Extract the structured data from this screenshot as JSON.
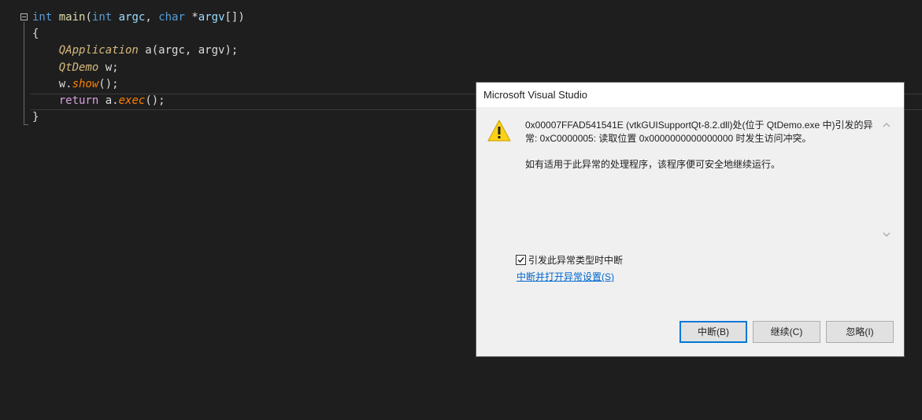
{
  "editor": {
    "lines": [
      {
        "tokens": [
          {
            "t": "int",
            "c": "kw"
          },
          {
            "t": " ",
            "c": "tx"
          },
          {
            "t": "main",
            "c": "fn"
          },
          {
            "t": "(",
            "c": "tx"
          },
          {
            "t": "int",
            "c": "kw"
          },
          {
            "t": " ",
            "c": "tx"
          },
          {
            "t": "argc",
            "c": "vr"
          },
          {
            "t": ", ",
            "c": "tx"
          },
          {
            "t": "char",
            "c": "kw"
          },
          {
            "t": " *",
            "c": "tx"
          },
          {
            "t": "argv",
            "c": "vr"
          },
          {
            "t": "[])",
            "c": "tx"
          }
        ]
      },
      {
        "tokens": [
          {
            "t": "{",
            "c": "tx"
          }
        ]
      },
      {
        "tokens": [
          {
            "t": "    ",
            "c": "tx"
          },
          {
            "t": "QApplication",
            "c": "ty-i"
          },
          {
            "t": " a(argc, argv);",
            "c": "tx"
          }
        ]
      },
      {
        "tokens": [
          {
            "t": "    ",
            "c": "tx"
          },
          {
            "t": "QtDemo",
            "c": "ty-i"
          },
          {
            "t": " w;",
            "c": "tx"
          }
        ]
      },
      {
        "tokens": [
          {
            "t": "    w.",
            "c": "tx"
          },
          {
            "t": "show",
            "c": "mth"
          },
          {
            "t": "();",
            "c": "tx"
          }
        ]
      },
      {
        "tokens": [
          {
            "t": "    ",
            "c": "tx"
          },
          {
            "t": "return",
            "c": "kw2"
          },
          {
            "t": " a.",
            "c": "tx"
          },
          {
            "t": "exec",
            "c": "mth"
          },
          {
            "t": "();",
            "c": "tx"
          }
        ]
      },
      {
        "tokens": [
          {
            "t": "}",
            "c": "tx"
          }
        ]
      }
    ]
  },
  "dialog": {
    "title": "Microsoft Visual Studio",
    "icon": "warning-icon",
    "message_line1": "0x00007FFAD541541E (vtkGUISupportQt-8.2.dll)处(位于 QtDemo.exe 中)引发的异常: 0xC0000005: 读取位置 0x0000000000000000 时发生访问冲突。",
    "message_line2": "如有适用于此异常的处理程序，该程序便可安全地继续运行。",
    "checkbox_label": "引发此异常类型时中断",
    "checkbox_checked": true,
    "link_text": "中断并打开异常设置(S)",
    "buttons": {
      "break": "中断(B)",
      "continue": "继续(C)",
      "ignore": "忽略(I)"
    },
    "accent_color": "#0078d7",
    "warning_color": "#fcd116"
  }
}
